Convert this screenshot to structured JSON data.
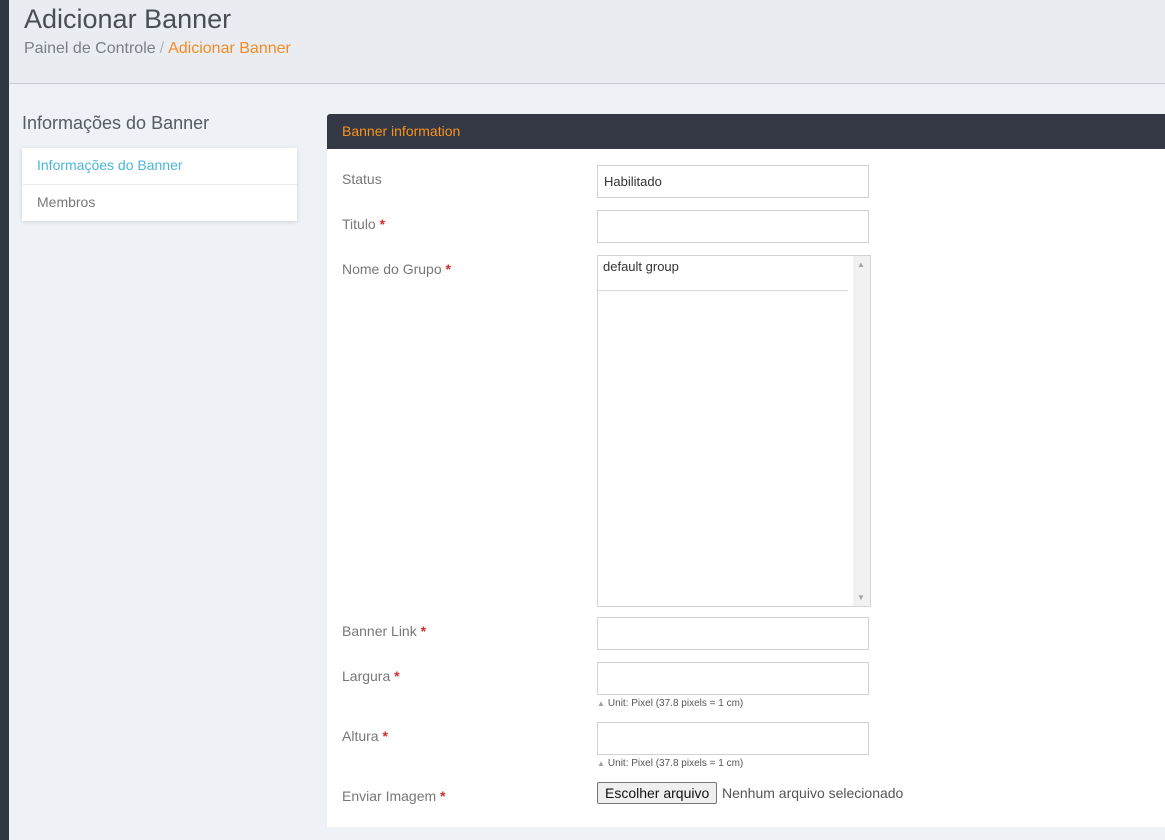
{
  "header": {
    "title": "Adicionar Banner",
    "breadcrumb": [
      "Painel de Controle",
      "Adicionar Banner"
    ],
    "breadcrumb_separator": "/"
  },
  "sidebar": {
    "title": "Informações do Banner",
    "items": [
      {
        "label": "Informações do Banner",
        "active": true
      },
      {
        "label": "Membros",
        "active": false
      }
    ]
  },
  "panel": {
    "heading": "Banner information",
    "required_marker": "*",
    "fields": {
      "status": {
        "label": "Status",
        "value": "Habilitado"
      },
      "titulo": {
        "label": "Titulo",
        "value": ""
      },
      "nome_grupo": {
        "label": "Nome do Grupo",
        "options": [
          "default group"
        ]
      },
      "banner_link": {
        "label": "Banner Link",
        "value": ""
      },
      "largura": {
        "label": "Largura",
        "value": "",
        "hint": "Unit: Pixel (37.8 pixels = 1 cm)"
      },
      "altura": {
        "label": "Altura",
        "value": "",
        "hint": "Unit: Pixel (37.8 pixels = 1 cm)"
      },
      "enviar_imagem": {
        "label": "Enviar Imagem",
        "button": "Escolher arquivo",
        "status": "Nenhum arquivo selecionado"
      }
    }
  },
  "colors": {
    "accent_orange": "#f28c28",
    "active_link": "#4bb5d6",
    "panel_heading_bg": "#333844",
    "required": "#d12d2d"
  }
}
